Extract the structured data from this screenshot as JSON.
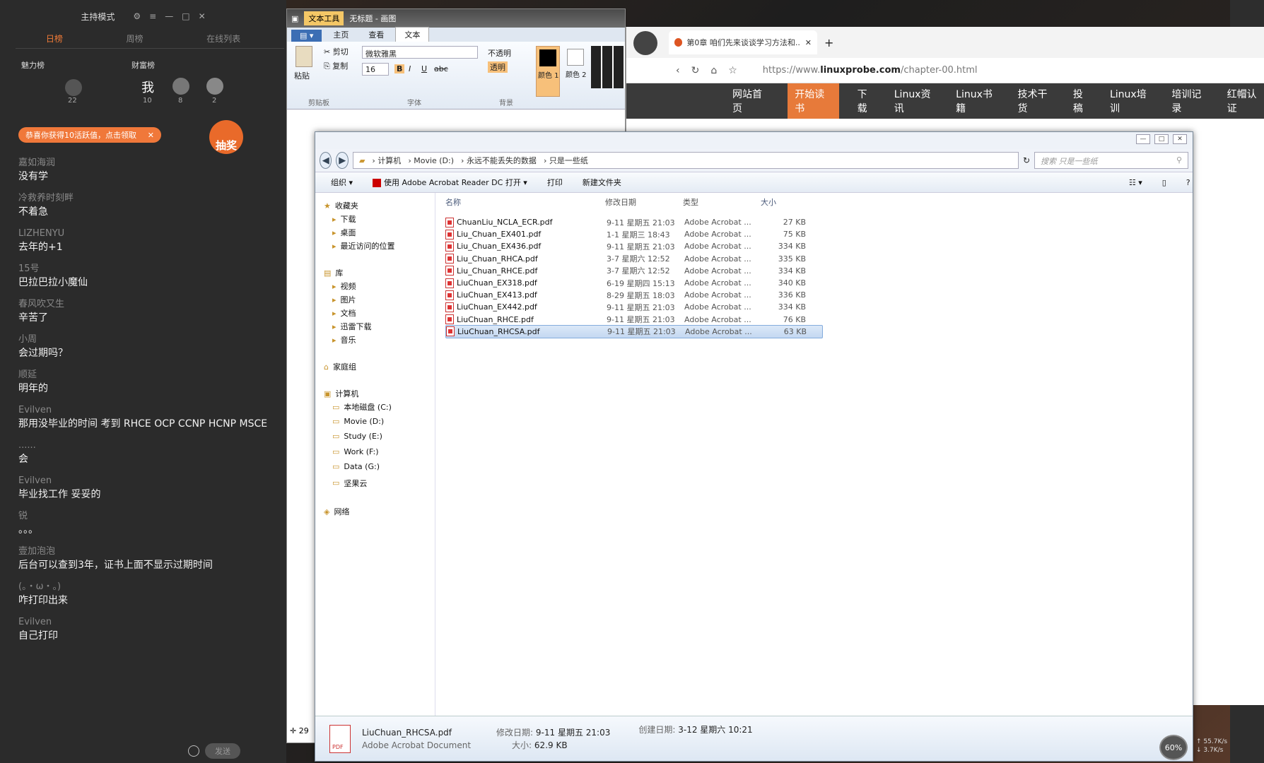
{
  "live": {
    "mode": "主持模式",
    "tabs": [
      "日榜",
      "周榜",
      "在线列表"
    ],
    "rank_charm": "魅力榜",
    "rank_wealth": "财富榜",
    "rank_me": "我",
    "rank_values": [
      "22",
      "10",
      "8",
      "2"
    ],
    "banner": "恭喜你获得10活跃值，点击领取",
    "lottery": "抽奖",
    "messages": [
      {
        "u": "嘉如海润",
        "t": "没有学"
      },
      {
        "u": "冷救养时刻畔",
        "t": "不着急"
      },
      {
        "u": "LIZHENYU",
        "t": "去年的+1"
      },
      {
        "u": "15号",
        "t": "巴拉巴拉小魔仙"
      },
      {
        "u": "春风吹又生",
        "t": "辛苦了"
      },
      {
        "u": "小周",
        "t": "会过期吗？"
      },
      {
        "u": "顺延",
        "t": "明年的"
      },
      {
        "u": "Evilven",
        "t": "那用没毕业的时间   考到 RHCE   OCP   CCNP   HCNP   MSCE"
      },
      {
        "u": "......",
        "t": "会"
      },
      {
        "u": "Evilven",
        "t": "毕业找工作 妥妥的"
      },
      {
        "u": "锐",
        "t": "。。。"
      },
      {
        "u": "壹加泡泡",
        "t": "后台可以查到3年，证书上面不显示过期时间"
      },
      {
        "u": "(。・ω・。)",
        "t": "咋打印出来"
      },
      {
        "u": "Evilven",
        "t": "自己打印"
      }
    ],
    "send": "发送"
  },
  "wordpad": {
    "ctx_tab": "文本工具",
    "title": "无标题 - 画图",
    "tabs": [
      "主页",
      "查看",
      "文本"
    ],
    "paste": "粘贴",
    "cut": "剪切",
    "copy": "复制",
    "font": "微软雅黑",
    "size": "16",
    "bold": "B",
    "italic": "I",
    "underline": "U",
    "strike": "abc",
    "opaque": "不透明",
    "transparent": "透明",
    "color1": "颜色 1",
    "color2": "颜色 2",
    "grp_clipboard": "剪贴板",
    "grp_font": "字体",
    "grp_bg": "背景",
    "status": "29"
  },
  "browser": {
    "tab_title": "第0章 咱们先来谈谈学习方法和...",
    "url_prefix": "https://www.",
    "url_domain": "linuxprobe.com",
    "url_path": "/chapter-00.html",
    "nav": [
      "网站首页",
      "开始读书",
      "下载",
      "Linux资讯",
      "Linux书籍",
      "技术干货",
      "投稿",
      "Linux培训",
      "培训记录",
      "红帽认证"
    ]
  },
  "explorer": {
    "path": [
      "计算机",
      "Movie (D:)",
      "永远不能丢失的数据",
      "只是一些纸"
    ],
    "search_placeholder": "搜索 只是一些纸",
    "cmd": [
      "组织 ▾",
      "使用 Adobe Acrobat Reader DC 打开 ▾",
      "打印",
      "新建文件夹"
    ],
    "nav": {
      "favorites": "收藏夹",
      "fav_items": [
        "下载",
        "桌面",
        "最近访问的位置"
      ],
      "library": "库",
      "lib_items": [
        "视频",
        "图片",
        "文档",
        "迅雷下载",
        "音乐"
      ],
      "homegroup": "家庭组",
      "computer": "计算机",
      "drives": [
        "本地磁盘 (C:)",
        "Movie (D:)",
        "Study (E:)",
        "Work (F:)",
        "Data (G:)",
        "坚果云"
      ],
      "network": "网络"
    },
    "columns": [
      "名称",
      "修改日期",
      "类型",
      "大小"
    ],
    "files": [
      {
        "name": "ChuanLiu_NCLA_ECR.pdf",
        "date": "9-11 星期五 21:03",
        "type": "Adobe Acrobat ...",
        "size": "27 KB"
      },
      {
        "name": "Liu_Chuan_EX401.pdf",
        "date": "1-1 星期三 18:43",
        "type": "Adobe Acrobat ...",
        "size": "75 KB"
      },
      {
        "name": "Liu_Chuan_EX436.pdf",
        "date": "9-11 星期五 21:03",
        "type": "Adobe Acrobat ...",
        "size": "334 KB"
      },
      {
        "name": "Liu_Chuan_RHCA.pdf",
        "date": "3-7 星期六 12:52",
        "type": "Adobe Acrobat ...",
        "size": "335 KB"
      },
      {
        "name": "Liu_Chuan_RHCE.pdf",
        "date": "3-7 星期六 12:52",
        "type": "Adobe Acrobat ...",
        "size": "334 KB"
      },
      {
        "name": "LiuChuan_EX318.pdf",
        "date": "6-19 星期四 15:13",
        "type": "Adobe Acrobat ...",
        "size": "340 KB"
      },
      {
        "name": "LiuChuan_EX413.pdf",
        "date": "8-29 星期五 18:03",
        "type": "Adobe Acrobat ...",
        "size": "336 KB"
      },
      {
        "name": "LiuChuan_EX442.pdf",
        "date": "9-11 星期五 21:03",
        "type": "Adobe Acrobat ...",
        "size": "334 KB"
      },
      {
        "name": "LiuChuan_RHCE.pdf",
        "date": "9-11 星期五 21:03",
        "type": "Adobe Acrobat ...",
        "size": "76 KB"
      },
      {
        "name": "LiuChuan_RHCSA.pdf",
        "date": "9-11 星期五 21:03",
        "type": "Adobe Acrobat ...",
        "size": "63 KB"
      }
    ],
    "details": {
      "name": "LiuChuan_RHCSA.pdf",
      "type": "Adobe Acrobat Document",
      "mod_label": "修改日期:",
      "mod_val": "9-11 星期五 21:03",
      "size_label": "大小:",
      "size_val": "62.9 KB",
      "created_label": "创建日期:",
      "created_val": "3-12 星期六 10:21"
    }
  },
  "system": {
    "net_percent": "60%",
    "up": "55.7K/s",
    "down": "3.7K/s"
  },
  "colors": {
    "accent": "#f0783a",
    "selection": "#c4d8f1"
  }
}
